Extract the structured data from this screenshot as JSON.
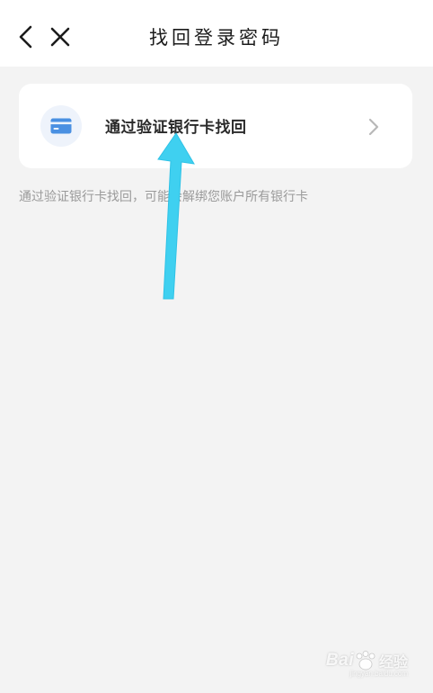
{
  "header": {
    "title": "找回登录密码",
    "back_icon": "chevron-left-icon",
    "close_icon": "close-icon"
  },
  "recovery_option": {
    "label": "通过验证银行卡找回",
    "icon": "bank-card-icon",
    "chevron_icon": "chevron-right-icon"
  },
  "hint": "通过验证银行卡找回，可能会解绑您账户所有银行卡",
  "watermark": {
    "brand": "Bai",
    "brand_suffix": "经验",
    "url": "jingyan.baidu.com"
  },
  "colors": {
    "background": "#f3f3f3",
    "card": "#ffffff",
    "icon_blue": "#4a90e2",
    "arrow": "#3fd0f0"
  }
}
